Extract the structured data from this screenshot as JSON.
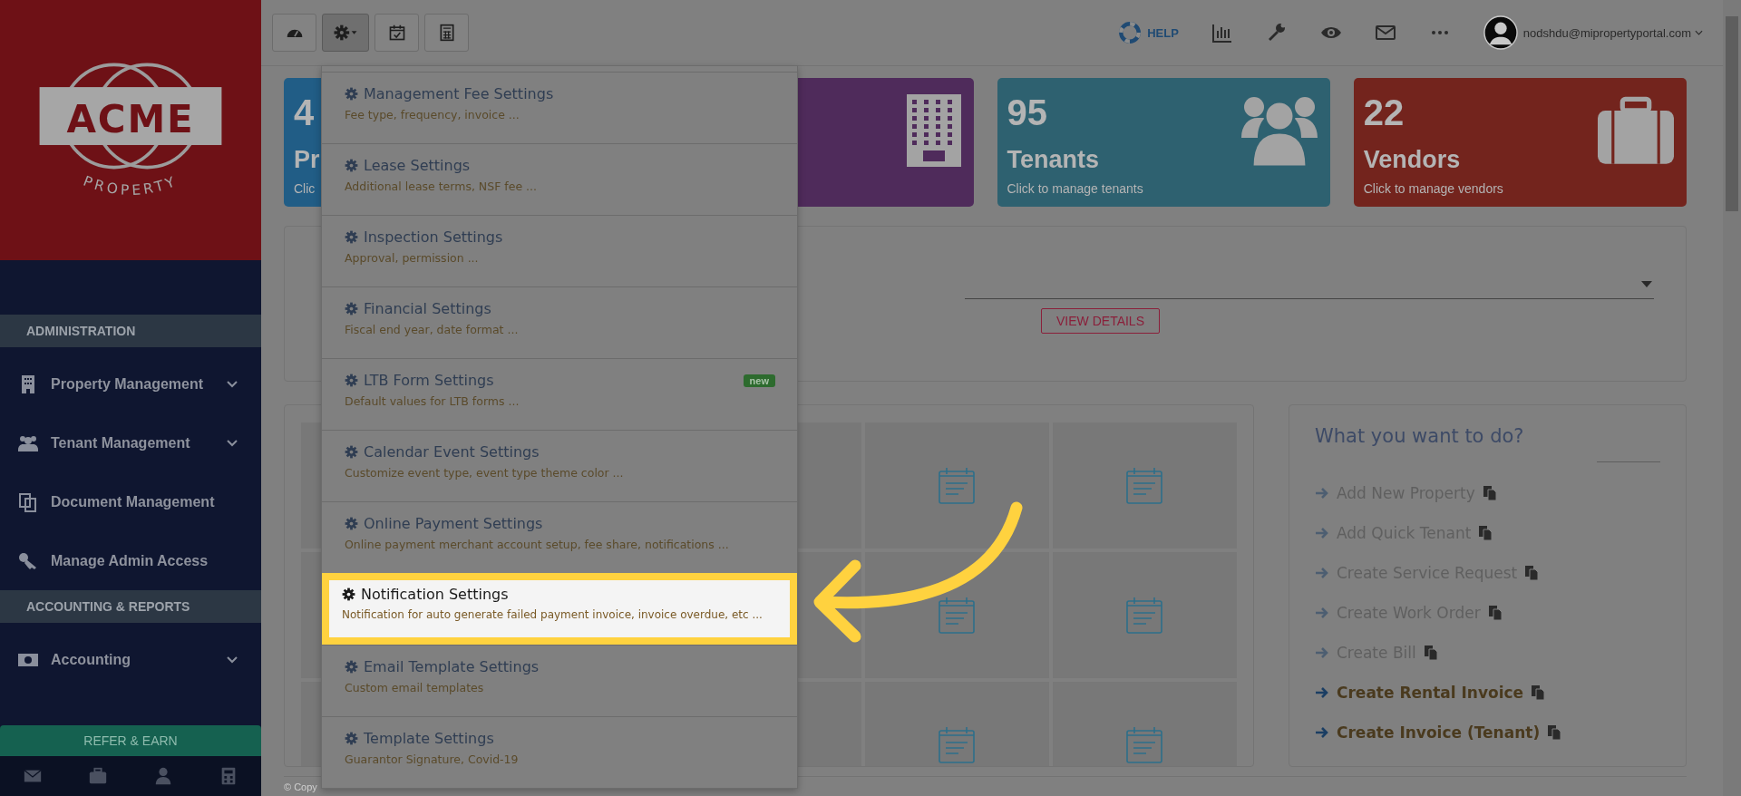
{
  "sidebar": {
    "logo": {
      "name": "ACME",
      "tagline": "PROPERTY"
    },
    "sections": [
      {
        "title": "ADMINISTRATION",
        "items": [
          {
            "label": "Property Management",
            "kind": "building",
            "expandable": true
          },
          {
            "label": "Tenant Management",
            "kind": "users",
            "expandable": true
          },
          {
            "label": "Document Management",
            "kind": "documents",
            "expandable": false
          },
          {
            "label": "Manage Admin Access",
            "kind": "key",
            "expandable": false
          }
        ]
      },
      {
        "title": "ACCOUNTING & REPORTS",
        "items": [
          {
            "label": "Accounting",
            "kind": "money",
            "expandable": true
          }
        ]
      }
    ],
    "refer_button": "REFER & EARN",
    "footer_icons": [
      {
        "kind": "mail"
      },
      {
        "kind": "briefcase"
      },
      {
        "kind": "user"
      },
      {
        "kind": "calculator"
      }
    ]
  },
  "toolbar": {
    "buttons": [
      {
        "kind": "dashboard",
        "selected": false
      },
      {
        "kind": "settings",
        "selected": true
      },
      {
        "kind": "calendar",
        "selected": false
      },
      {
        "kind": "calculator",
        "selected": false
      }
    ]
  },
  "header": {
    "help": "HELP",
    "icons": [
      {
        "kind": "chart"
      },
      {
        "kind": "wrench"
      },
      {
        "kind": "eye"
      },
      {
        "kind": "mail"
      },
      {
        "kind": "more"
      }
    ],
    "user_email": "nodshdu@mipropertyportal.com"
  },
  "stat_cards": [
    {
      "number": "4",
      "title": "Pr",
      "subtitle": "Clic",
      "color": "#215d86",
      "kind": "none"
    },
    {
      "color": "#4f2b5b",
      "kind": "building"
    },
    {
      "number": "95",
      "title": "Tenants",
      "subtitle": "Click to manage tenants",
      "color": "#2e6170",
      "kind": "users"
    },
    {
      "number": "22",
      "title": "Vendors",
      "subtitle": "Click to manage vendors",
      "color": "#73241d",
      "kind": "briefcase"
    }
  ],
  "panel": {
    "button": "VIEW DETAILS"
  },
  "quick_actions": {
    "title": "What you want to do?",
    "items": [
      {
        "label": "Add New Property",
        "faded": true
      },
      {
        "label": "Add Quick Tenant",
        "faded": true
      },
      {
        "label": "Create Service Request",
        "faded": true
      },
      {
        "label": "Create Work Order",
        "faded": true
      },
      {
        "label": "Create Bill",
        "faded": true
      },
      {
        "label": "Create Rental Invoice",
        "faded": false
      },
      {
        "label": "Create Invoice (Tenant)",
        "faded": false
      }
    ]
  },
  "settings_menu": {
    "items": [
      {
        "title": "Management Fee Settings",
        "description": "Fee type, frequency, invoice ...",
        "selected": false
      },
      {
        "title": "Lease Settings",
        "description": "Additional lease terms, NSF fee ...",
        "selected": false
      },
      {
        "title": "Inspection Settings",
        "description": "Approval, permission ...",
        "selected": false
      },
      {
        "title": "Financial Settings",
        "description": "Fiscal end year, date format ...",
        "selected": false
      },
      {
        "title": "LTB Form Settings",
        "description": "Default values for LTB forms ...",
        "badge": "new",
        "selected": false
      },
      {
        "title": "Calendar Event Settings",
        "description": "Customize event type, event type theme color ...",
        "selected": false
      },
      {
        "title": "Online Payment Settings",
        "description": "Online payment merchant account setup, fee share, notifications ...",
        "selected": false
      },
      {
        "title": "Notification Settings",
        "description": "Notification for auto generate failed payment invoice, invoice overdue, etc ...",
        "selected": true
      },
      {
        "title": "Email Template Settings",
        "description": "Custom email templates",
        "selected": false
      },
      {
        "title": "Template Settings",
        "description": "Guarantor Signature, Covid-19",
        "selected": false
      }
    ]
  },
  "footer": {
    "copyright": "© Copy"
  }
}
